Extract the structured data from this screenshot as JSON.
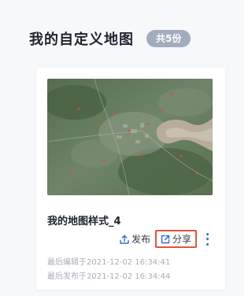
{
  "header": {
    "title": "我的自定义地图",
    "count_badge": "共5份"
  },
  "card": {
    "map_name": "我的地图样式_4",
    "actions": {
      "publish_label": "发布",
      "share_label": "分享"
    },
    "last_edited": "最后编辑于2021-12-02 16:34:41",
    "last_published": "最后发布于2021-12-02 16:34:44"
  },
  "colors": {
    "accent_blue": "#2f6bd9",
    "highlight_red": "#e8523a",
    "badge_gray": "#a3acbf"
  }
}
